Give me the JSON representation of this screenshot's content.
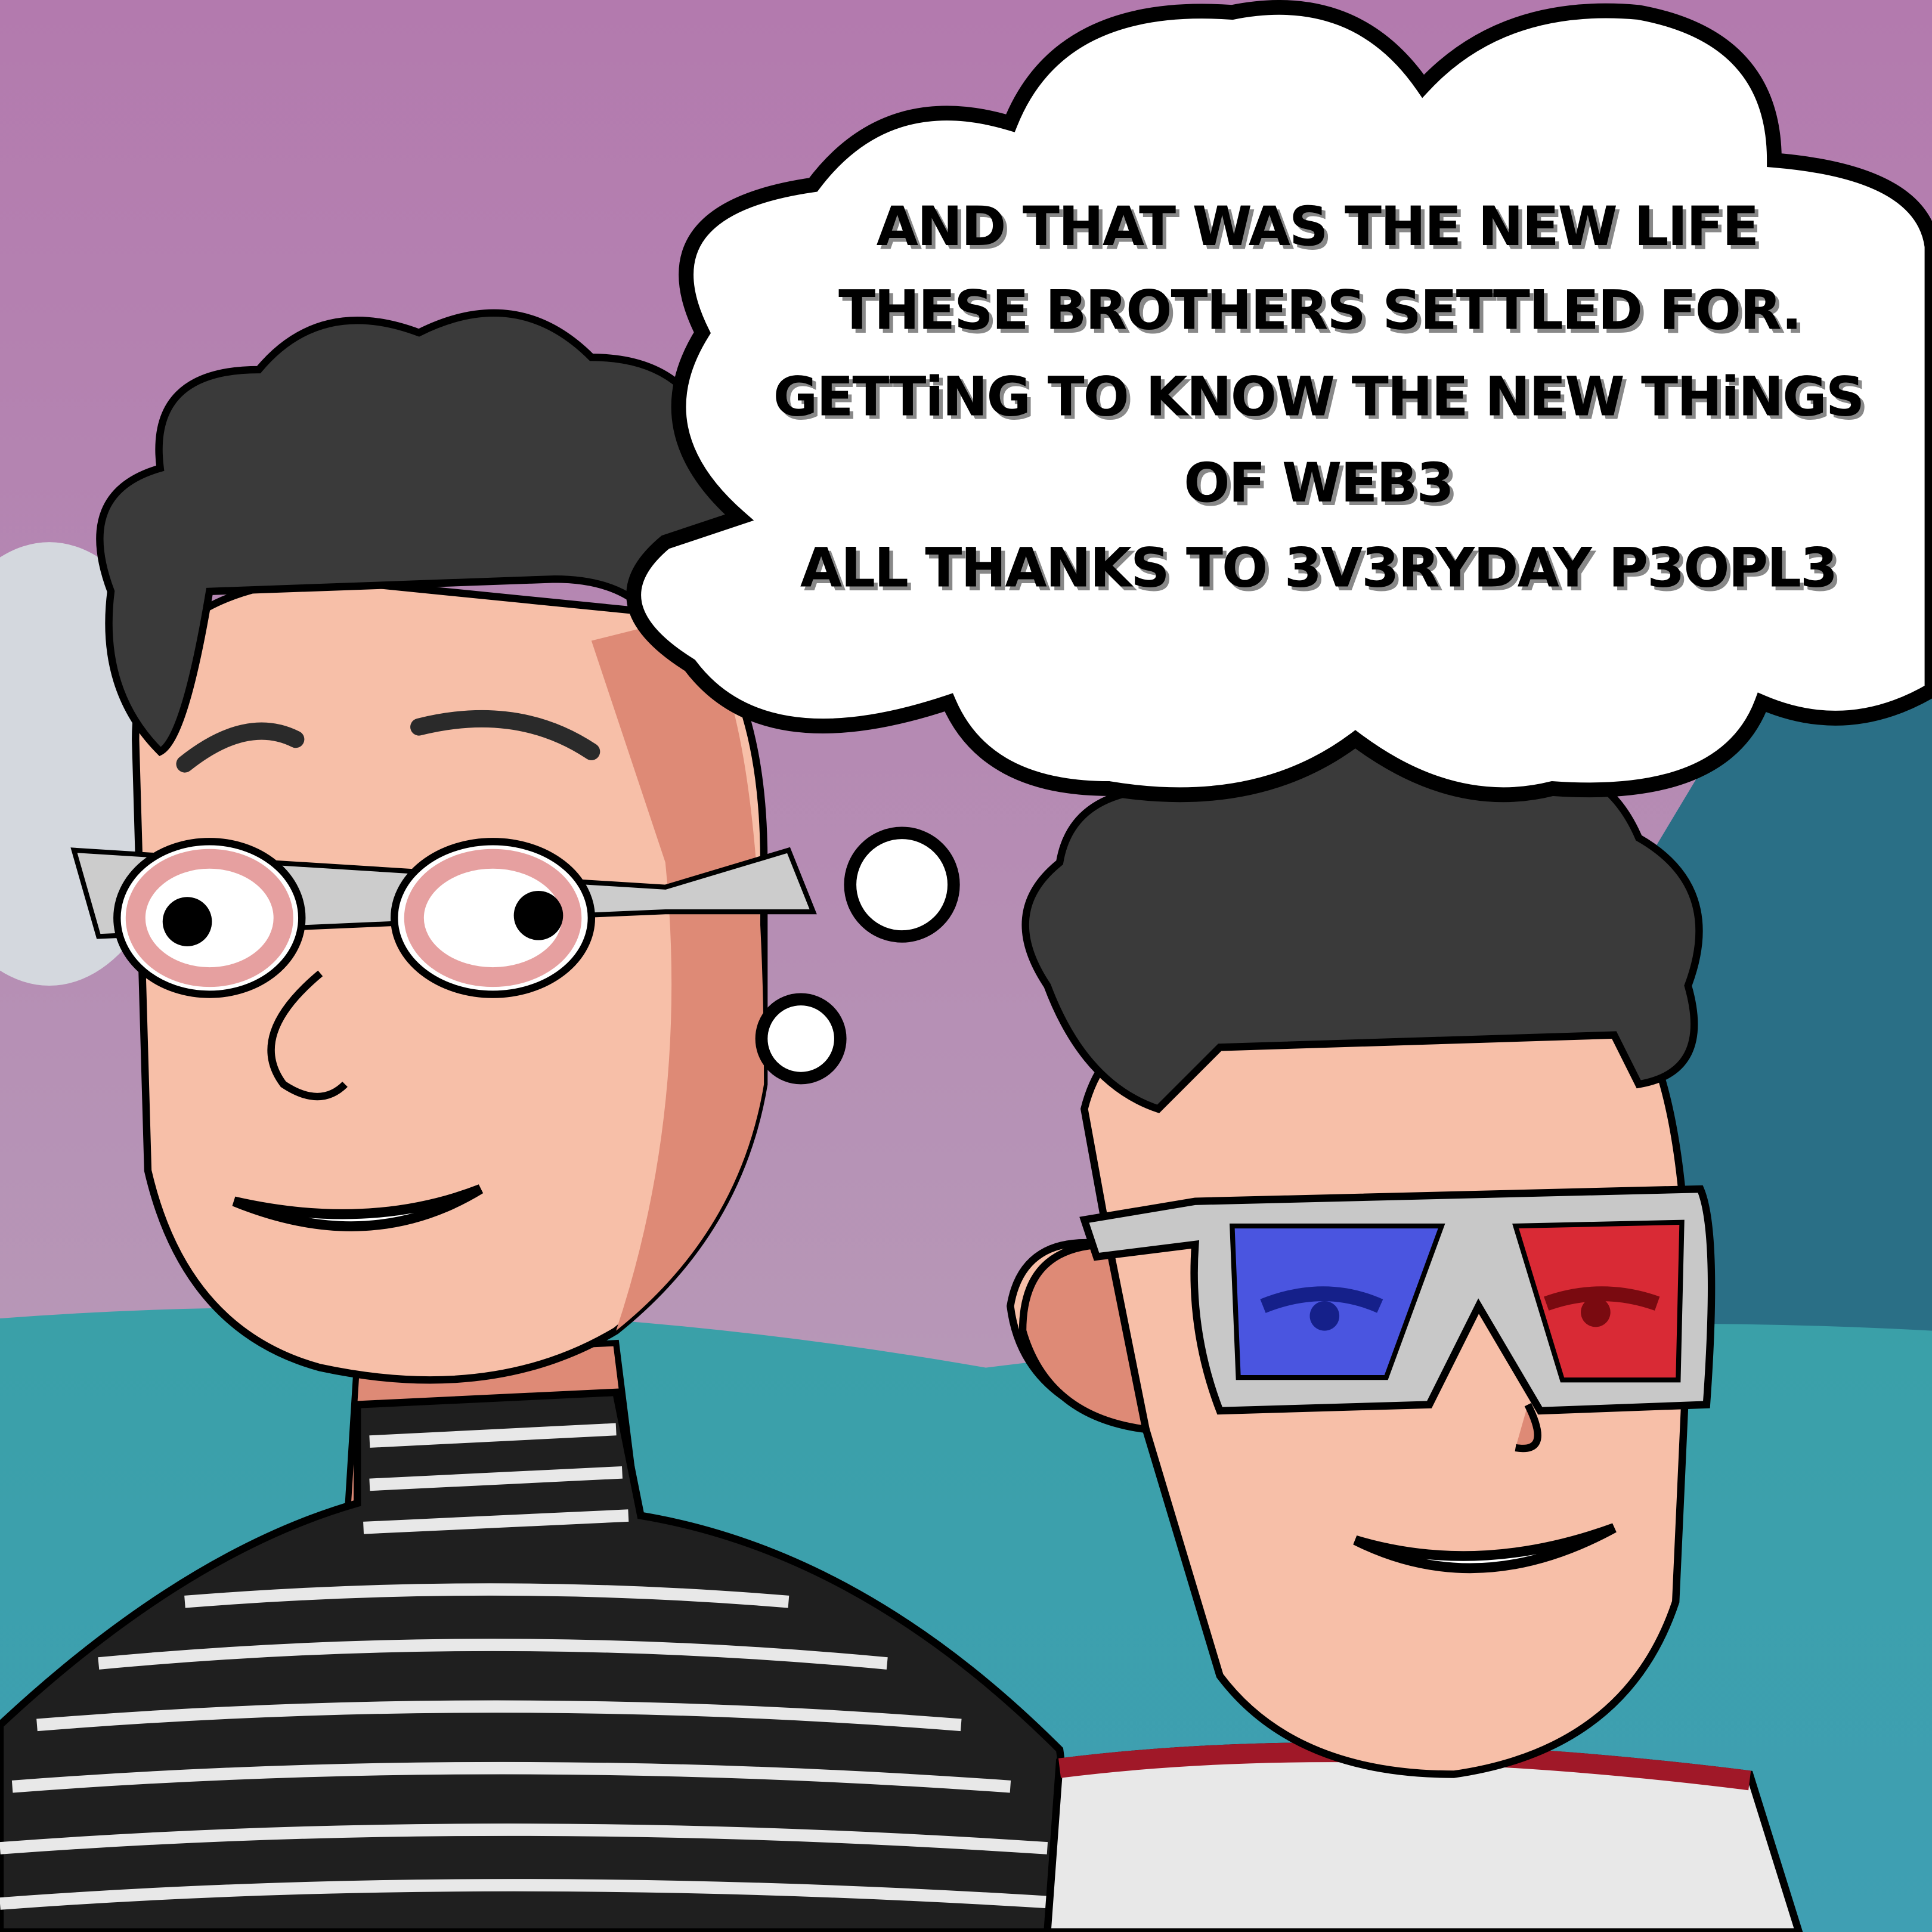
{
  "thought_bubble": {
    "lines": [
      "AND THAT WAS THE NEW LIFE",
      "THESE BROTHERS SETTLED FOR.",
      "GETTiNG TO KNOW THE NEW THiNGS",
      "OF WEB3",
      "ALL THANKS TO 3V3RYDAY P3OPL3"
    ]
  },
  "colors": {
    "sky": "#b57daf",
    "ground": "#3a9aa6",
    "skin": "#f7bfa8",
    "skin_shadow": "#de8a76",
    "hair": "#3a3a3a",
    "lens_blue": "#4a55e0",
    "lens_red": "#d92a35"
  }
}
